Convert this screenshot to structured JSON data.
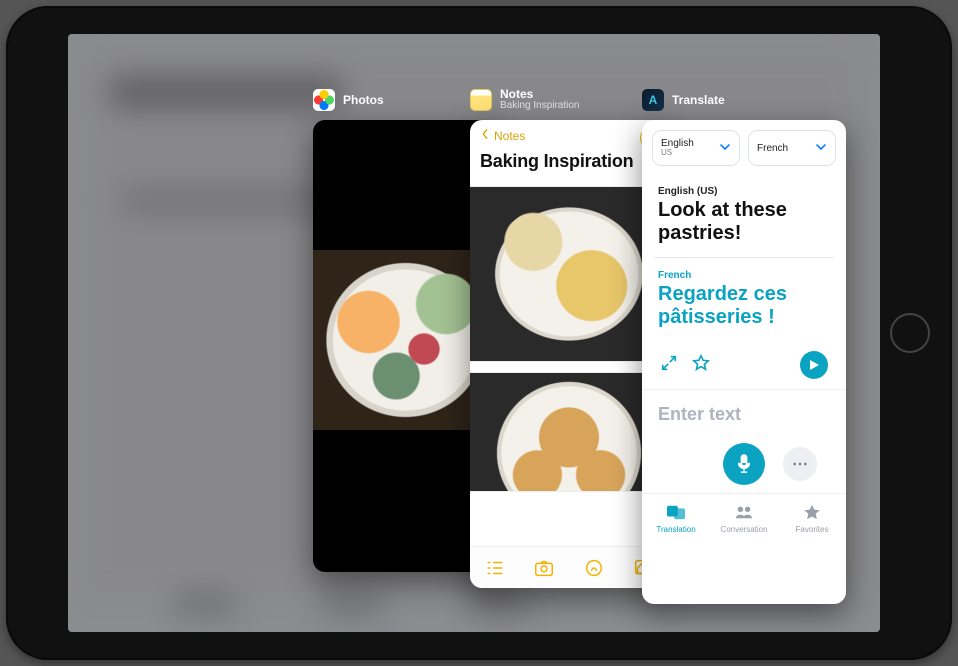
{
  "switcher": {
    "photos": {
      "appName": "Photos"
    },
    "notes": {
      "appName": "Notes",
      "subtitle": "Baking Inspiration",
      "backLabel": "Notes",
      "noteTitle": "Baking Inspiration"
    },
    "translate": {
      "appName": "Translate",
      "sourceLang": {
        "name": "English",
        "region": "US"
      },
      "targetLang": {
        "name": "French",
        "region": ""
      },
      "sourceFullLabel": "English (US)",
      "sourceText": "Look at these pastries!",
      "targetLabel": "French",
      "targetText": "Regardez ces pâtisseries !",
      "inputPlaceholder": "Enter text",
      "tabs": {
        "translation": "Translation",
        "conversation": "Conversation",
        "favorites": "Favorites"
      }
    }
  }
}
